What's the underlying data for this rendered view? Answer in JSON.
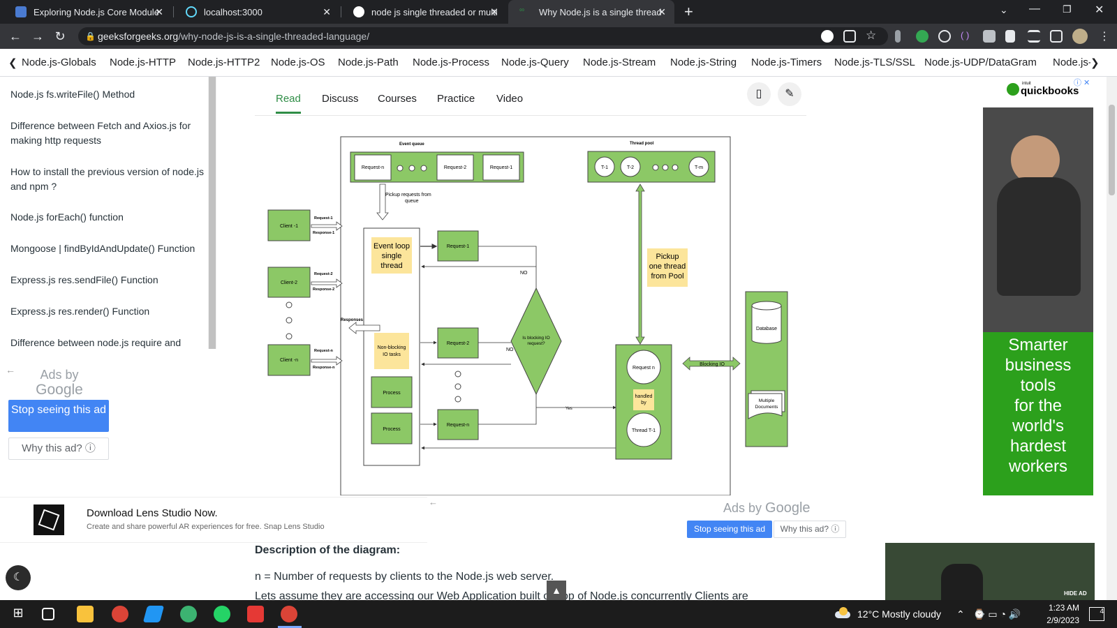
{
  "browser": {
    "tabs": [
      {
        "title": "Exploring Node.js Core Modules",
        "icon": "react-doc-icon",
        "color": "#4a7bd1"
      },
      {
        "title": "localhost:3000",
        "icon": "react-icon",
        "color": "#61dafb"
      },
      {
        "title": "node js single threaded or multit",
        "icon": "google-icon",
        "color": "#ffffff"
      },
      {
        "title": "Why Node.js is a single threaded",
        "icon": "gfg-icon",
        "color": "#2f8d46"
      }
    ],
    "new_tab": "+",
    "url_host": "geeksforgeeks.org",
    "url_path": "/why-node-js-is-a-single-threaded-language/"
  },
  "bookmarks": [
    "Node.js-Globals",
    "Node.js-HTTP",
    "Node.js-HTTP2",
    "Node.js-OS",
    "Node.js-Path",
    "Node.js-Process",
    "Node.js-Query",
    "Node.js-Stream",
    "Node.js-String",
    "Node.js-Timers",
    "Node.js-TLS/SSL",
    "Node.js-UDP/DataGram",
    "Node.js-"
  ],
  "left_nav": {
    "items": [
      "Node.js fs.writeFile() Method",
      "Difference between Fetch and Axios.js for making http requests",
      "How to install the previous version of node.js and npm ?",
      "Node.js forEach() function",
      "Mongoose | findByIdAndUpdate() Function",
      "Express.js res.sendFile() Function",
      "Express.js res.render() Function",
      "Difference between node.js require and"
    ]
  },
  "ads_left": {
    "ads_by": "Ads by",
    "google": "Google",
    "stop": "Stop seeing this ad",
    "why": "Why this ad? ⓘ"
  },
  "content_nav": {
    "tabs": [
      "Read",
      "Discuss",
      "Courses",
      "Practice",
      "Video"
    ]
  },
  "diagram": {
    "event_queue_title": "Event queue",
    "thread_pool_title": "Thread pool",
    "queue_requests": [
      "Request-n",
      "Request-2",
      "Request-1"
    ],
    "threads": [
      "T-1",
      "T-2",
      "T-m"
    ],
    "pickup_queue": [
      "Pickup requests from",
      "queue"
    ],
    "clients": [
      "Client -1",
      "Client-2",
      "Client -n"
    ],
    "req_labels": [
      "Request-1",
      "Request-2",
      "Request-n"
    ],
    "resp_labels": [
      "Response-1",
      "Response-2",
      "Response-n"
    ],
    "event_loop": [
      "Event loop",
      "single",
      "thread"
    ],
    "non_blocking": [
      "Non-blocking",
      "IO tasks"
    ],
    "process": "Process",
    "responses": "Responses",
    "inner_requests": [
      "Request-1",
      "Request-2",
      "Request-n"
    ],
    "decision": [
      "Is blocking IO",
      "request?"
    ],
    "no": "NO",
    "yes": "Yes",
    "pickup_pool": [
      "Pickup",
      "one thread",
      "from Pool"
    ],
    "request_n": "Request n",
    "handled_by": [
      "handled",
      "by"
    ],
    "thread_t1": "Thread T-1",
    "blocking_io": "Blocking IO",
    "database": "Database",
    "multiple_docs": [
      "Multiple",
      "Documents"
    ]
  },
  "right_ad": {
    "brand": "quickbooks",
    "brand_small": "intuit",
    "copy": [
      "Smarter",
      "business",
      "tools",
      "for the",
      "world's",
      "hardest",
      "workers"
    ]
  },
  "lens_ad": {
    "title": "Download Lens Studio Now.",
    "sub": "Create and share powerful AR experiences for free. Snap Lens Studio"
  },
  "ads2": {
    "ads_by": "Ads by",
    "google": "Google",
    "stop": "Stop seeing this ad",
    "why": "Why this ad? ⓘ"
  },
  "description": {
    "heading": "Description of the diagram:",
    "line1": "n = Number of requests by clients to the Node.js web server.",
    "line2": "Lets assume they are accessing our Web Application built on top of Node.js concurrently Clients are"
  },
  "bottom_ad": {
    "hide": "HIDE AD"
  },
  "taskbar": {
    "weather": "12°C  Mostly cloudy",
    "time": "1:23 AM",
    "date": "2/9/2023",
    "notif": "4"
  }
}
